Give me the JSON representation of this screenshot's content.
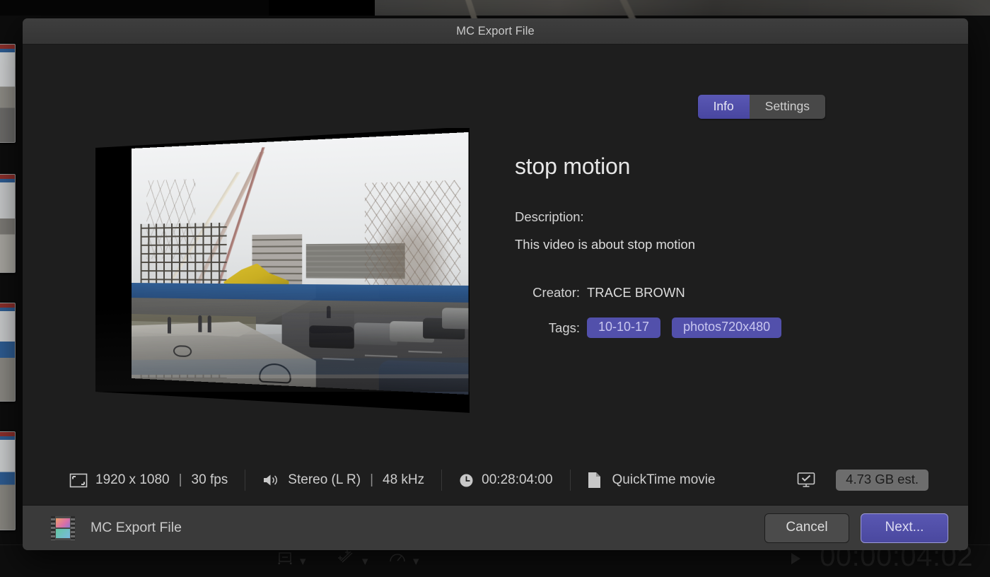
{
  "window": {
    "title": "MC Export File"
  },
  "tabs": [
    {
      "label": "Info",
      "active": true
    },
    {
      "label": "Settings",
      "active": false
    }
  ],
  "info": {
    "title": "stop motion",
    "description_label": "Description:",
    "description_value": "This video is about stop motion",
    "creator_label": "Creator:",
    "creator_value": "TRACE BROWN",
    "tags_label": "Tags:",
    "tags": [
      "10-10-17",
      "photos720x480"
    ]
  },
  "metadata": {
    "resolution": "1920 x 1080",
    "framerate": "30 fps",
    "audio_channels": "Stereo (L R)",
    "sample_rate": "48 kHz",
    "duration": "00:28:04:00",
    "format": "QuickTime movie",
    "size_estimate": "4.73 GB est.",
    "separator": "|"
  },
  "footer": {
    "app_name": "MC Export File",
    "cancel_label": "Cancel",
    "next_label": "Next..."
  },
  "background": {
    "timecode": "00:00:04:02"
  },
  "colors": {
    "accent_purple": "#5250ab",
    "tag_text": "#c9c7f0",
    "dialog_body": "#1e1e1e",
    "titlebar": "#3a3a3a",
    "footer": "#3a3a3a",
    "size_badge": "#6d6d6d"
  }
}
